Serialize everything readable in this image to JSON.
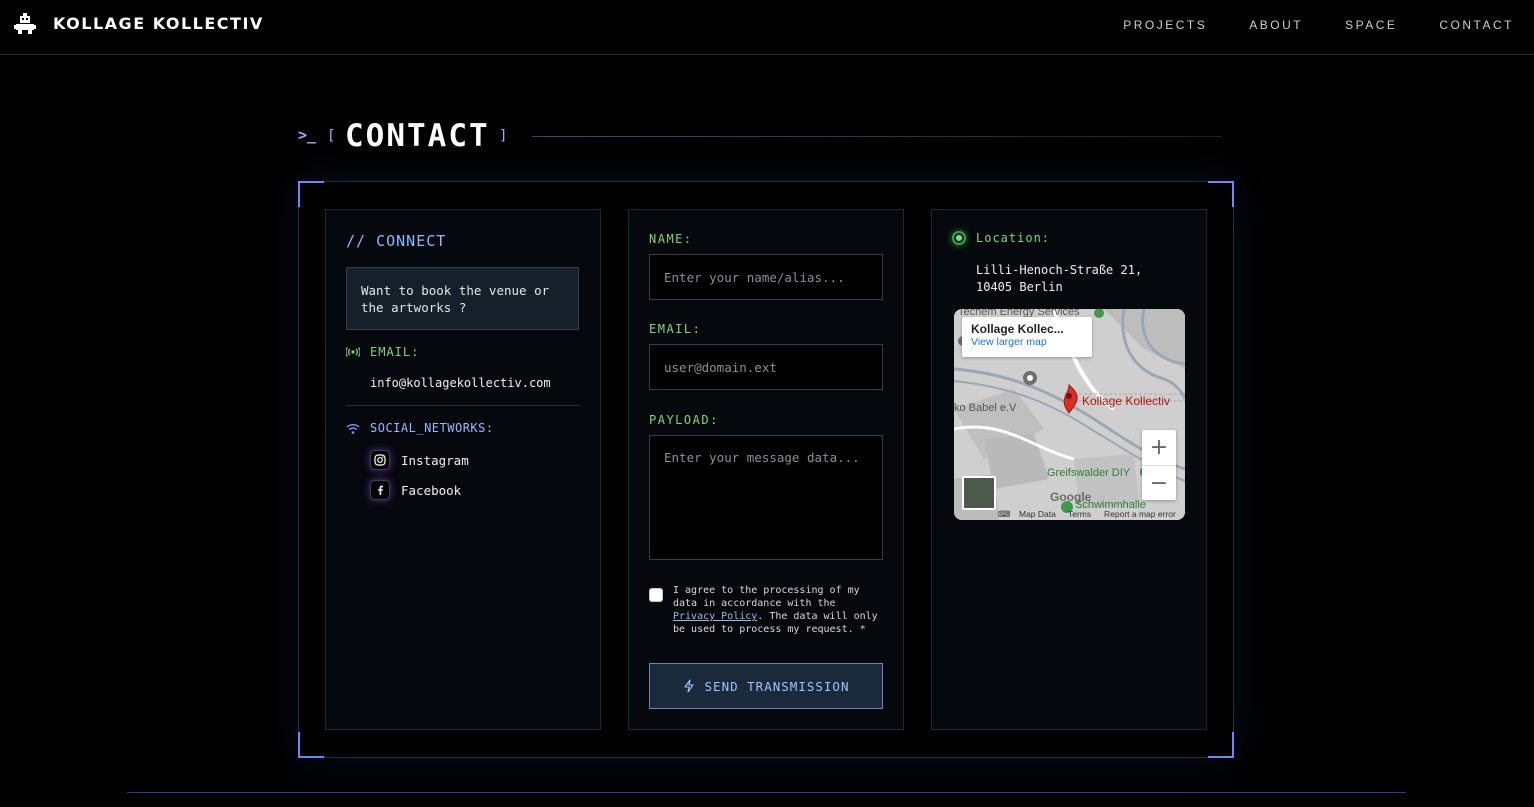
{
  "header": {
    "logo_text": "KOLLAGE KOLLECTIV",
    "nav": [
      "PROJECTS",
      "ABOUT",
      "SPACE",
      "CONTACT"
    ]
  },
  "section": {
    "prompt_glyph": ">_",
    "bracket_open": "[",
    "bracket_close": "]",
    "title": "CONTACT"
  },
  "connect": {
    "title": "// CONNECT",
    "intro": "Want to book the venue or the artworks ?",
    "email_label": "EMAIL:",
    "email": "info@kollagekollectiv.com",
    "social_label": "SOCIAL_NETWORKS:",
    "social": [
      {
        "name": "Instagram",
        "icon": "instagram-icon"
      },
      {
        "name": "Facebook",
        "icon": "facebook-icon"
      }
    ]
  },
  "form": {
    "name_label": "NAME:",
    "name_placeholder": "Enter your name/alias...",
    "email_label": "EMAIL:",
    "email_placeholder": "user@domain.ext",
    "message_label": "PAYLOAD:",
    "message_placeholder": "Enter your message data...",
    "agree_before": "I agree to the processing of my data in accordance with the ",
    "agree_link": "Privacy Policy",
    "agree_after": ". The data will only be used to process my request. *",
    "send_label": "SEND TRANSMISSION"
  },
  "location": {
    "label": "Location:",
    "address_line1": "Lilli-Henoch-Straße 21,",
    "address_line2": "10405 Berlin",
    "map": {
      "card_title": "Kollage Kollec...",
      "card_link": "View larger map",
      "pin_label": "Kollage Kollectiv",
      "poi_1": "Techem Energy Services",
      "poi_2": "ko Babel e.V",
      "poi_3": "Greifswalder DIY",
      "poi_4": "Schwimmhalle",
      "google": "Google",
      "footer_data": "Map Data",
      "footer_terms": "Terms",
      "footer_report": "Report a map error"
    }
  },
  "colors": {
    "accent_blue": "#6f86ff",
    "label_green": "#7ed57e",
    "pin_red": "#b31412"
  }
}
